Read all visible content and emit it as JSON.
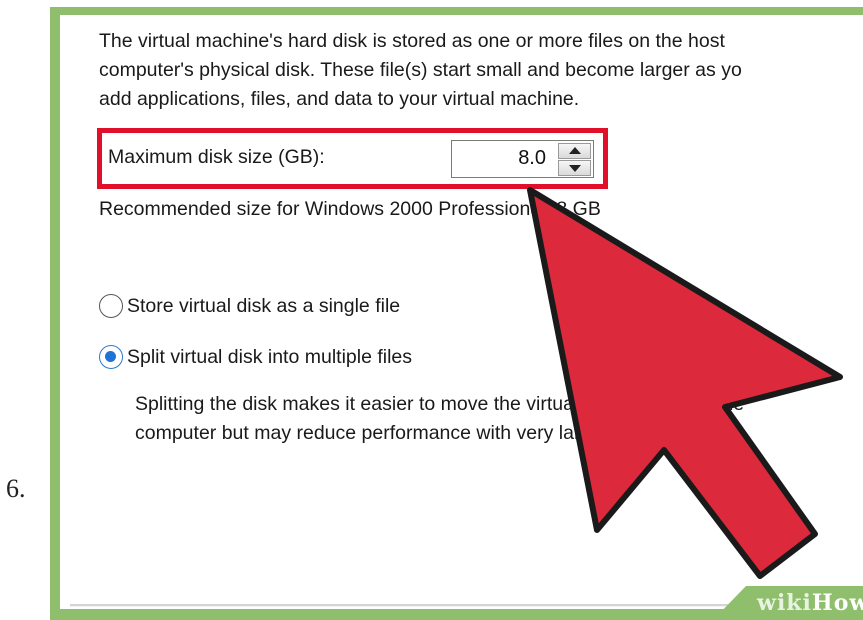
{
  "step": {
    "number": "6."
  },
  "dialog": {
    "intro_lines": [
      "The virtual machine's hard disk is stored as one or more files on the host",
      "computer's physical disk. These file(s) start small and become larger as yo",
      "add applications, files, and data to your virtual machine."
    ],
    "max_disk_size": {
      "label": "Maximum disk size (GB):",
      "value": "8.0"
    },
    "recommended": "Recommended size for Windows 2000 Professional: 8 GB",
    "options": [
      {
        "label": "Store virtual disk as a single file",
        "selected": false
      },
      {
        "label": "Split virtual disk into multiple files",
        "selected": true
      }
    ],
    "split_description_lines": [
      "Splitting the disk makes it easier to move the virtual machine to anothe",
      "computer but may reduce performance with very large disks."
    ]
  },
  "watermark": {
    "part1": "wiki",
    "part2": "How"
  },
  "colors": {
    "highlight": "#e0102a",
    "cursor": "#dc2a3c",
    "frame": "#8fbf6d",
    "radio_selected": "#1f72d6"
  },
  "icons": {
    "cursor": "arrow-cursor-icon",
    "spin_up": "arrow-up-icon",
    "spin_down": "arrow-down-icon"
  }
}
